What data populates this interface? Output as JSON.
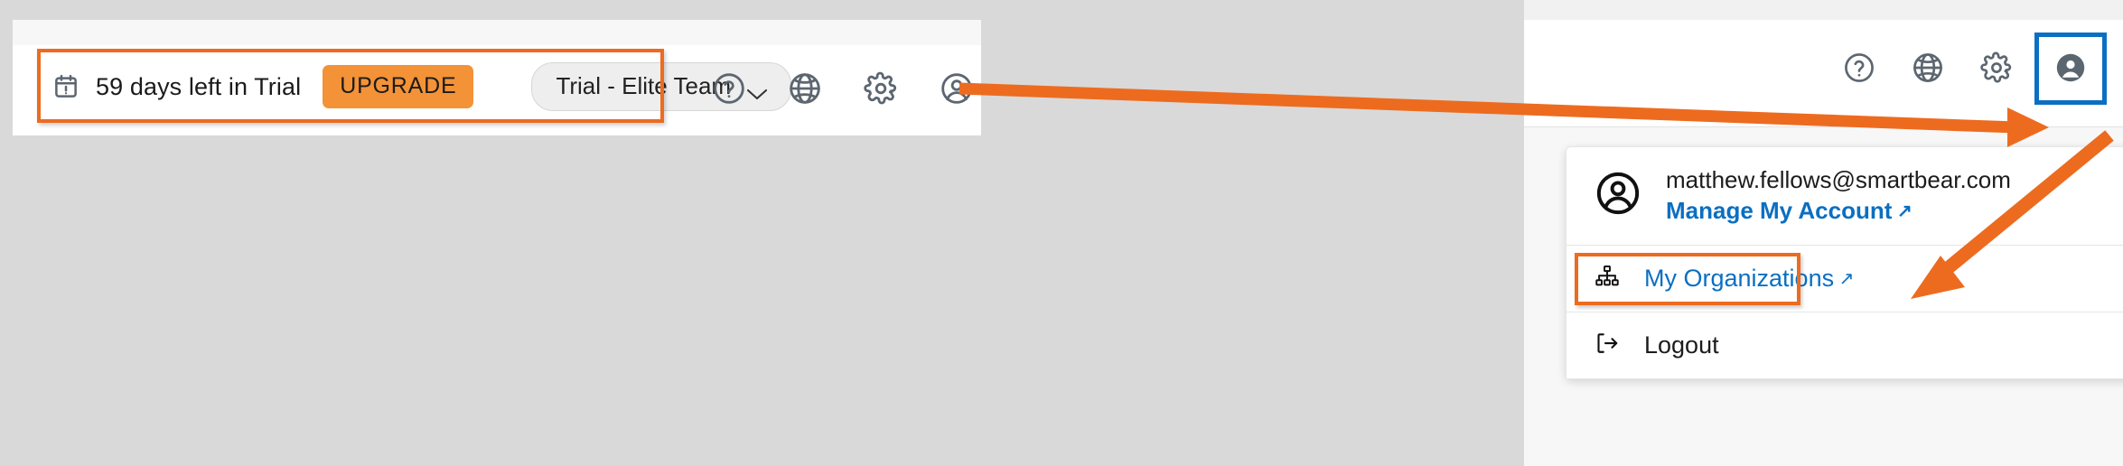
{
  "left_panel": {
    "trial": {
      "calendar_icon": "calendar-alert-icon",
      "days_text": "59 days left in Trial",
      "upgrade_label": "UPGRADE",
      "plan_label": "Trial - Elite Team",
      "plan_chevron_icon": "chevron-down-icon"
    },
    "icons": [
      {
        "name": "help-icon",
        "glyph": "?"
      },
      {
        "name": "globe-icon",
        "glyph": ""
      },
      {
        "name": "settings-gear-icon",
        "glyph": ""
      },
      {
        "name": "account-avatar-icon",
        "glyph": ""
      }
    ]
  },
  "right_panel": {
    "icons": [
      {
        "name": "help-icon"
      },
      {
        "name": "globe-icon"
      },
      {
        "name": "settings-gear-icon"
      },
      {
        "name": "account-avatar-icon"
      }
    ],
    "menu": {
      "email": "matthew.fellows@smartbear.com",
      "manage_account_label": "Manage My Account",
      "manage_account_external_icon": "external-link-arrow",
      "items": [
        {
          "label": "My Organizations",
          "icon": "org-hierarchy-icon",
          "external": "↗",
          "is_link": true
        },
        {
          "label": "Logout",
          "icon": "logout-icon",
          "external": "",
          "is_link": false
        }
      ]
    }
  },
  "annotations": {
    "highlight_orange": "#ED6B1F",
    "highlight_blue": "#0A6FC2",
    "arrow_color": "#ED6B1F",
    "accent_upgrade": "#F39237",
    "link_blue": "#0A6FC2"
  }
}
